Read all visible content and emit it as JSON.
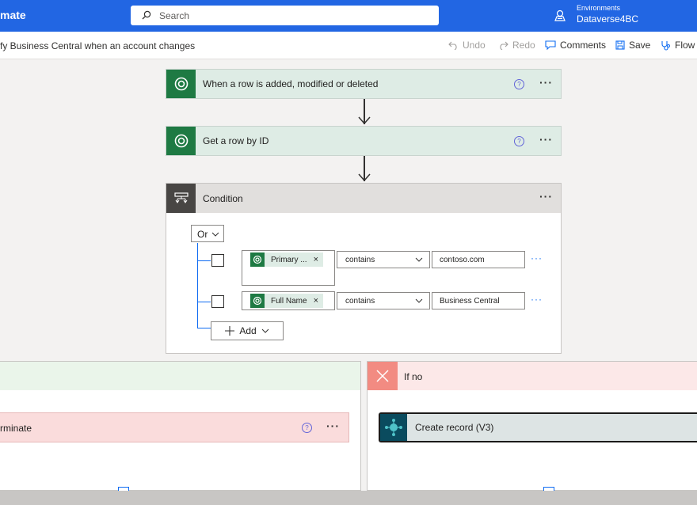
{
  "header": {
    "app_title": "mate",
    "search_placeholder": "Search",
    "environment_label": "Environments",
    "environment_name": "Dataverse4BC"
  },
  "commandbar": {
    "flow_name": "fy Business Central when an account changes",
    "undo": "Undo",
    "redo": "Redo",
    "comments": "Comments",
    "save": "Save",
    "flow_checker": "Flow"
  },
  "steps": {
    "trigger_title": "When a row is added, modified or deleted",
    "get_row_title": "Get a row by ID",
    "condition_title": "Condition",
    "help_glyph": "?",
    "more_glyph": "···"
  },
  "condition": {
    "operator": "Or",
    "rows": [
      {
        "token": "Primary ...",
        "op": "contains",
        "value": "contoso.com"
      },
      {
        "token": "Full Name",
        "op": "contains",
        "value": "Business Central"
      }
    ],
    "token_remove_glyph": "×",
    "row_more_glyph": "···",
    "add_label": "Add"
  },
  "branches": {
    "yes_action_title": "rminate",
    "no_title": "If no",
    "no_action_title": "Create record (V3)"
  },
  "colors": {
    "topbar": "#2266e3",
    "dataverse_green": "#1e7a43",
    "card_green_bg": "#deece5",
    "condition_dark": "#484644",
    "no_branch_red": "#f28b82",
    "terminate_bg": "#fadcdc",
    "bc_teal": "#0a4b5e"
  }
}
